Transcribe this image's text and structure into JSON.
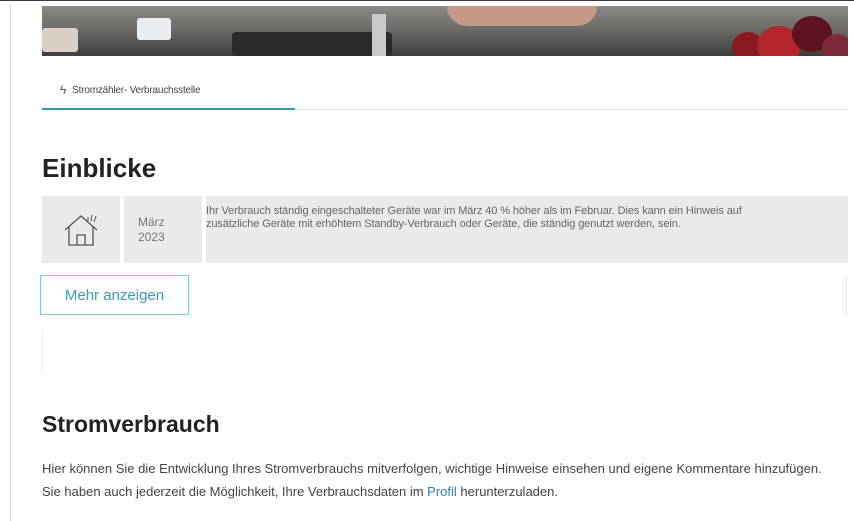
{
  "tabs": [
    {
      "icon": "lightning-icon",
      "label": "Stromzähler- Verbrauchsstelle"
    }
  ],
  "insights": {
    "title": "Einblicke",
    "items": [
      {
        "icon": "house-icon",
        "month": "März",
        "year": "2023",
        "text": "Ihr Verbrauch ständig eingeschalteter Geräte war im März 40 % höher als im Februar. Dies kann ein Hinweis auf zusätzliche Geräte mit erhöhtem Standby-Verbrauch oder Geräte, die ständig genutzt werden, sein."
      }
    ],
    "more_label": "Mehr anzeigen"
  },
  "consumption": {
    "title": "Stromverbrauch",
    "desc_before": "Hier können Sie die Entwicklung Ihres Stromverbrauchs mitverfolgen, wichtige Hinweise einsehen und eigene Kommentare hinzufügen. Sie haben auch jederzeit die Möglichkeit, Ihre Verbrauchsdaten im ",
    "profile_link": "Profil",
    "desc_after": " herunterzuladen."
  },
  "colors": {
    "accent": "#3b96a8",
    "link": "#2d7fb0",
    "card_bg": "#eaeaea"
  }
}
